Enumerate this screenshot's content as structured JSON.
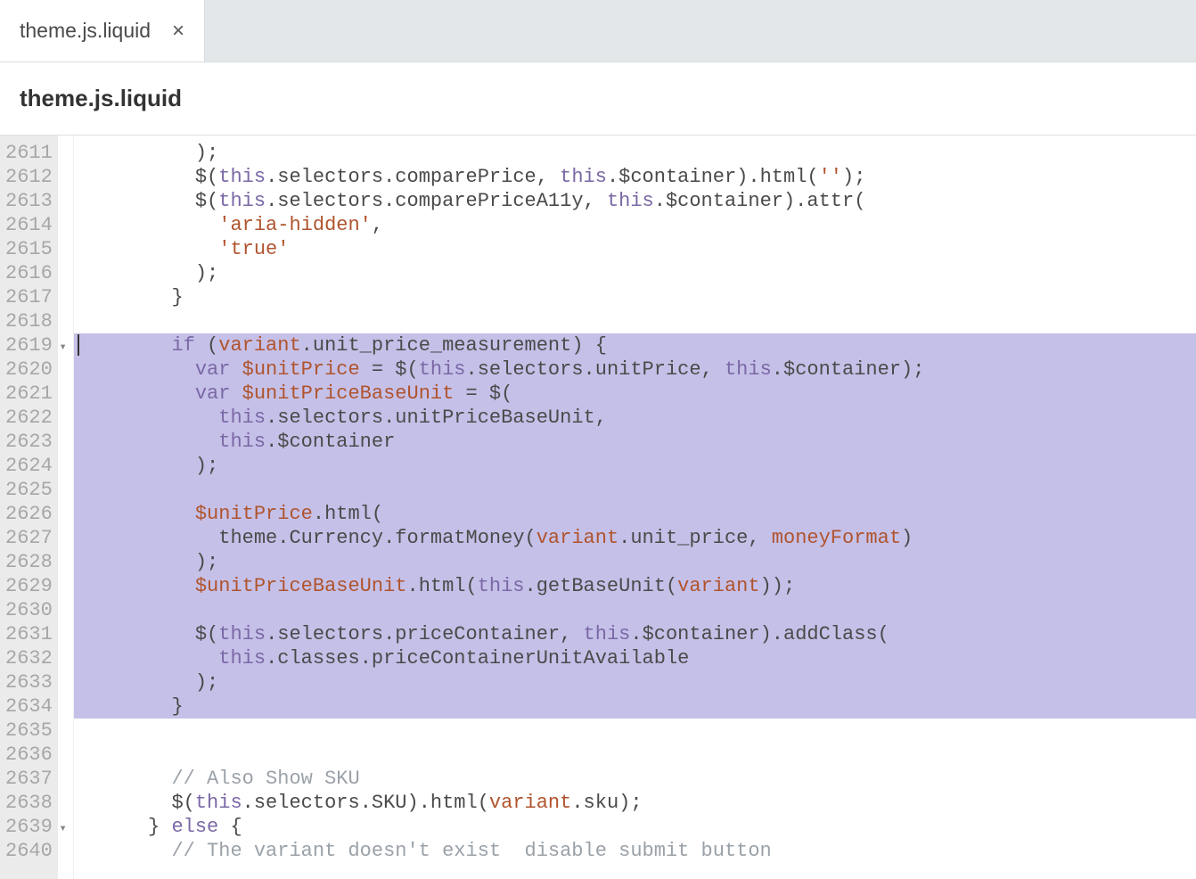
{
  "tab": {
    "label": "theme.js.liquid"
  },
  "file_header": "theme.js.liquid",
  "gutter": {
    "start": 2611,
    "end": 2640,
    "fold_lines": [
      2619,
      2639
    ]
  },
  "highlight": {
    "start": 2619,
    "end": 2634
  },
  "code": {
    "2611": [
      [
        "pad10",
        ""
      ],
      [
        "op",
        ");"
      ]
    ],
    "2612": [
      [
        "pad10",
        ""
      ],
      [
        "id",
        "$"
      ],
      [
        "op",
        "("
      ],
      [
        "key",
        "this"
      ],
      [
        "op",
        "."
      ],
      [
        "id",
        "selectors"
      ],
      [
        "op",
        "."
      ],
      [
        "id",
        "comparePrice"
      ],
      [
        "op",
        ", "
      ],
      [
        "key",
        "this"
      ],
      [
        "op",
        "."
      ],
      [
        "id",
        "$container"
      ],
      [
        "op",
        ")."
      ],
      [
        "id",
        "html"
      ],
      [
        "op",
        "("
      ],
      [
        "str",
        "''"
      ],
      [
        "op",
        ");"
      ]
    ],
    "2613": [
      [
        "pad10",
        ""
      ],
      [
        "id",
        "$"
      ],
      [
        "op",
        "("
      ],
      [
        "key",
        "this"
      ],
      [
        "op",
        "."
      ],
      [
        "id",
        "selectors"
      ],
      [
        "op",
        "."
      ],
      [
        "id",
        "comparePriceA11y"
      ],
      [
        "op",
        ", "
      ],
      [
        "key",
        "this"
      ],
      [
        "op",
        "."
      ],
      [
        "id",
        "$container"
      ],
      [
        "op",
        ")."
      ],
      [
        "id",
        "attr"
      ],
      [
        "op",
        "("
      ]
    ],
    "2614": [
      [
        "pad12",
        ""
      ],
      [
        "str",
        "'aria-hidden'"
      ],
      [
        "op",
        ","
      ]
    ],
    "2615": [
      [
        "pad12",
        ""
      ],
      [
        "str",
        "'true'"
      ]
    ],
    "2616": [
      [
        "pad10",
        ""
      ],
      [
        "op",
        ");"
      ]
    ],
    "2617": [
      [
        "pad8",
        ""
      ],
      [
        "op",
        "}"
      ]
    ],
    "2618": [
      [
        "pad0",
        ""
      ]
    ],
    "2619": [
      [
        "pad8",
        ""
      ],
      [
        "key",
        "if"
      ],
      [
        "op",
        " ("
      ],
      [
        "param",
        "variant"
      ],
      [
        "op",
        "."
      ],
      [
        "id",
        "unit_price_measurement"
      ],
      [
        "op",
        ") {"
      ]
    ],
    "2620": [
      [
        "pad10",
        ""
      ],
      [
        "key",
        "var"
      ],
      [
        "op",
        " "
      ],
      [
        "dollar",
        "$unitPrice"
      ],
      [
        "op",
        " = "
      ],
      [
        "id",
        "$"
      ],
      [
        "op",
        "("
      ],
      [
        "key",
        "this"
      ],
      [
        "op",
        "."
      ],
      [
        "id",
        "selectors"
      ],
      [
        "op",
        "."
      ],
      [
        "id",
        "unitPrice"
      ],
      [
        "op",
        ", "
      ],
      [
        "key",
        "this"
      ],
      [
        "op",
        "."
      ],
      [
        "id",
        "$container"
      ],
      [
        "op",
        ");"
      ]
    ],
    "2621": [
      [
        "pad10",
        ""
      ],
      [
        "key",
        "var"
      ],
      [
        "op",
        " "
      ],
      [
        "dollar",
        "$unitPriceBaseUnit"
      ],
      [
        "op",
        " = "
      ],
      [
        "id",
        "$"
      ],
      [
        "op",
        "("
      ]
    ],
    "2622": [
      [
        "pad12",
        ""
      ],
      [
        "key",
        "this"
      ],
      [
        "op",
        "."
      ],
      [
        "id",
        "selectors"
      ],
      [
        "op",
        "."
      ],
      [
        "id",
        "unitPriceBaseUnit"
      ],
      [
        "op",
        ","
      ]
    ],
    "2623": [
      [
        "pad12",
        ""
      ],
      [
        "key",
        "this"
      ],
      [
        "op",
        "."
      ],
      [
        "id",
        "$container"
      ]
    ],
    "2624": [
      [
        "pad10",
        ""
      ],
      [
        "op",
        ");"
      ]
    ],
    "2625": [
      [
        "pad0",
        ""
      ]
    ],
    "2626": [
      [
        "pad10",
        ""
      ],
      [
        "dollar",
        "$unitPrice"
      ],
      [
        "op",
        "."
      ],
      [
        "id",
        "html"
      ],
      [
        "op",
        "("
      ]
    ],
    "2627": [
      [
        "pad12",
        ""
      ],
      [
        "id",
        "theme"
      ],
      [
        "op",
        "."
      ],
      [
        "id",
        "Currency"
      ],
      [
        "op",
        "."
      ],
      [
        "id",
        "formatMoney"
      ],
      [
        "op",
        "("
      ],
      [
        "param",
        "variant"
      ],
      [
        "op",
        "."
      ],
      [
        "id",
        "unit_price"
      ],
      [
        "op",
        ", "
      ],
      [
        "param",
        "moneyFormat"
      ],
      [
        "op",
        ")"
      ]
    ],
    "2628": [
      [
        "pad10",
        ""
      ],
      [
        "op",
        ");"
      ]
    ],
    "2629": [
      [
        "pad10",
        ""
      ],
      [
        "dollar",
        "$unitPriceBaseUnit"
      ],
      [
        "op",
        "."
      ],
      [
        "id",
        "html"
      ],
      [
        "op",
        "("
      ],
      [
        "key",
        "this"
      ],
      [
        "op",
        "."
      ],
      [
        "id",
        "getBaseUnit"
      ],
      [
        "op",
        "("
      ],
      [
        "param",
        "variant"
      ],
      [
        "op",
        "));"
      ]
    ],
    "2630": [
      [
        "pad0",
        ""
      ]
    ],
    "2631": [
      [
        "pad10",
        ""
      ],
      [
        "id",
        "$"
      ],
      [
        "op",
        "("
      ],
      [
        "key",
        "this"
      ],
      [
        "op",
        "."
      ],
      [
        "id",
        "selectors"
      ],
      [
        "op",
        "."
      ],
      [
        "id",
        "priceContainer"
      ],
      [
        "op",
        ", "
      ],
      [
        "key",
        "this"
      ],
      [
        "op",
        "."
      ],
      [
        "id",
        "$container"
      ],
      [
        "op",
        ")."
      ],
      [
        "id",
        "addClass"
      ],
      [
        "op",
        "("
      ]
    ],
    "2632": [
      [
        "pad12",
        ""
      ],
      [
        "key",
        "this"
      ],
      [
        "op",
        "."
      ],
      [
        "id",
        "classes"
      ],
      [
        "op",
        "."
      ],
      [
        "id",
        "priceContainerUnitAvailable"
      ]
    ],
    "2633": [
      [
        "pad10",
        ""
      ],
      [
        "op",
        ");"
      ]
    ],
    "2634": [
      [
        "pad8",
        ""
      ],
      [
        "op",
        "}"
      ]
    ],
    "2635": [
      [
        "pad0",
        ""
      ]
    ],
    "2636": [
      [
        "pad0",
        ""
      ]
    ],
    "2637": [
      [
        "pad8",
        ""
      ],
      [
        "comment",
        "// Also Show SKU"
      ]
    ],
    "2638": [
      [
        "pad8",
        ""
      ],
      [
        "id",
        "$"
      ],
      [
        "op",
        "("
      ],
      [
        "key",
        "this"
      ],
      [
        "op",
        "."
      ],
      [
        "id",
        "selectors"
      ],
      [
        "op",
        "."
      ],
      [
        "id",
        "SKU"
      ],
      [
        "op",
        ")."
      ],
      [
        "id",
        "html"
      ],
      [
        "op",
        "("
      ],
      [
        "param",
        "variant"
      ],
      [
        "op",
        "."
      ],
      [
        "id",
        "sku"
      ],
      [
        "op",
        ");"
      ]
    ],
    "2639": [
      [
        "pad6",
        ""
      ],
      [
        "op",
        "} "
      ],
      [
        "key",
        "else"
      ],
      [
        "op",
        " {"
      ]
    ],
    "2640": [
      [
        "pad8",
        ""
      ],
      [
        "comment",
        "// The variant doesn't exist  disable submit button"
      ]
    ]
  },
  "icons": {
    "close": "×",
    "fold": "▾"
  }
}
